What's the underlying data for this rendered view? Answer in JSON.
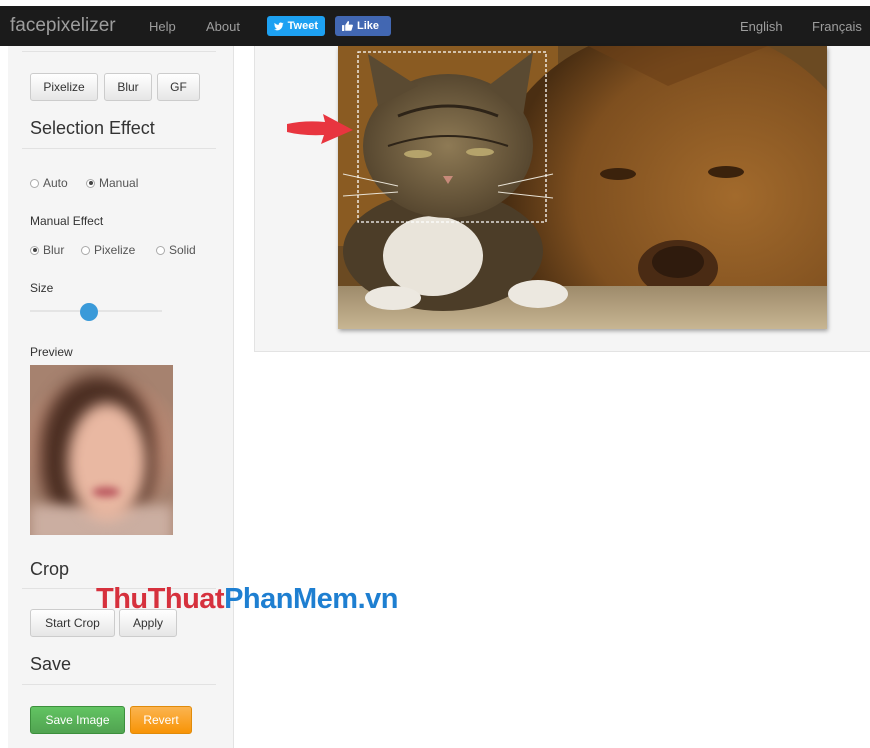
{
  "navbar": {
    "brand": "facepixelizer",
    "links": [
      "Help",
      "About"
    ],
    "tweet_label": "Tweet",
    "like_label": "Like",
    "languages": [
      "English",
      "Français"
    ]
  },
  "sidebar": {
    "effect_buttons": [
      "Pixelize",
      "Blur",
      "GF"
    ],
    "selection_effect_title": "Selection Effect",
    "selection_modes": [
      {
        "label": "Auto",
        "checked": false
      },
      {
        "label": "Manual",
        "checked": true
      }
    ],
    "manual_effect_label": "Manual Effect",
    "manual_effects": [
      {
        "label": "Blur",
        "checked": true
      },
      {
        "label": "Pixelize",
        "checked": false
      },
      {
        "label": "Solid",
        "checked": false
      }
    ],
    "size_label": "Size",
    "size_value_fraction": 0.45,
    "preview_label": "Preview",
    "crop_title": "Crop",
    "start_crop_label": "Start Crop",
    "apply_label": "Apply",
    "save_title": "Save",
    "save_image_label": "Save Image",
    "revert_label": "Revert"
  },
  "watermark": {
    "part1": "ThuThuat",
    "part2": "PhanMem",
    "part3": ".vn"
  },
  "colors": {
    "navbar_bg": "#1b1b1b",
    "tweet_blue": "#1da1f2",
    "like_blue": "#4267b2",
    "slider_knob": "#3a9ad9",
    "save_green": "#51a351",
    "revert_orange": "#f89406",
    "arrow_red": "#e8353f",
    "watermark_red": "#d6313d",
    "watermark_blue": "#1e7fd1"
  }
}
